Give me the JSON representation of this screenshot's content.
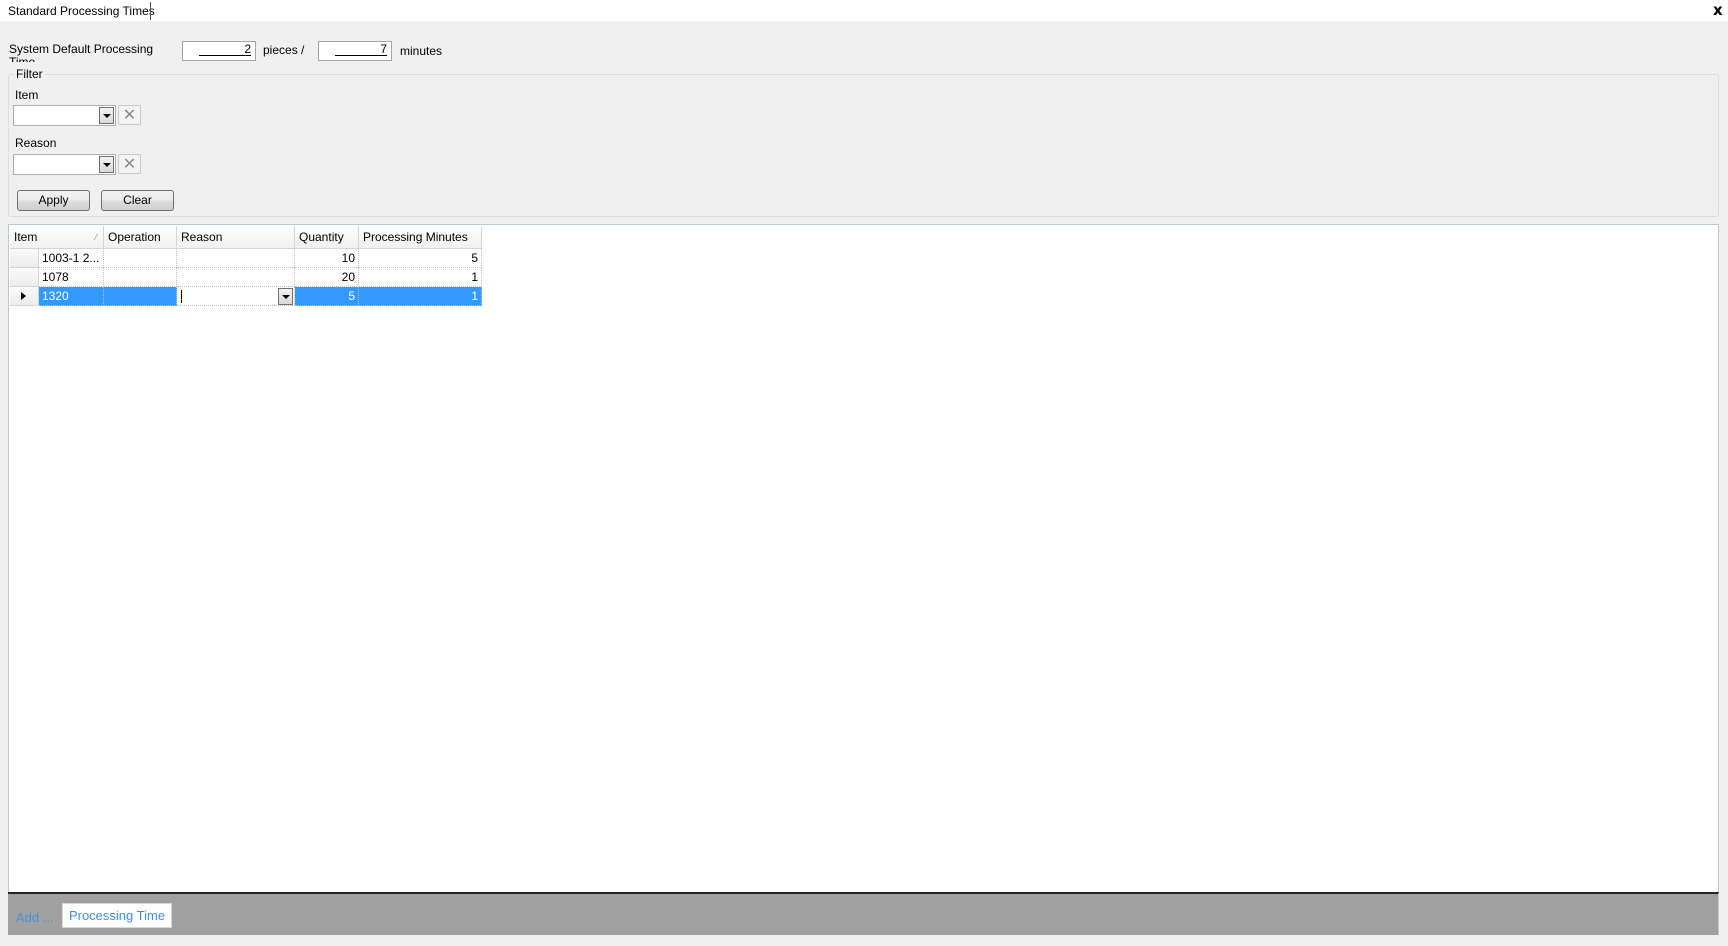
{
  "window": {
    "tab_title": "Standard Processing Times",
    "close_glyph": "x"
  },
  "defaults": {
    "label": "System Default Processing Time",
    "pieces_value": "2",
    "pieces_label": "pieces /",
    "minutes_value": "7",
    "minutes_label": "minutes"
  },
  "filter": {
    "title": "Filter",
    "item_label": "Item",
    "item_value": "",
    "reason_label": "Reason",
    "reason_value": "",
    "clear_glyph": "✕",
    "apply_label": "Apply",
    "clear_label": "Clear"
  },
  "grid": {
    "columns": [
      "Item",
      "Operation",
      "Reason",
      "Quantity",
      "Processing Minutes"
    ],
    "sort_column": "Item",
    "sort_glyph": "⁄",
    "rows": [
      {
        "item": "1003-1 2...",
        "operation": "",
        "reason": "",
        "quantity": "10",
        "processing_minutes": "5",
        "selected": false
      },
      {
        "item": "1078",
        "operation": "",
        "reason": "",
        "quantity": "20",
        "processing_minutes": "1",
        "selected": false
      },
      {
        "item": "1320",
        "operation": "",
        "reason": "",
        "quantity": "5",
        "processing_minutes": "1",
        "selected": true
      }
    ],
    "selection_color": "#3399ff"
  },
  "bottom_bar": {
    "add_label": "Add ...",
    "processing_time_label": "Processing Time",
    "link_color": "#3d8fe0"
  }
}
